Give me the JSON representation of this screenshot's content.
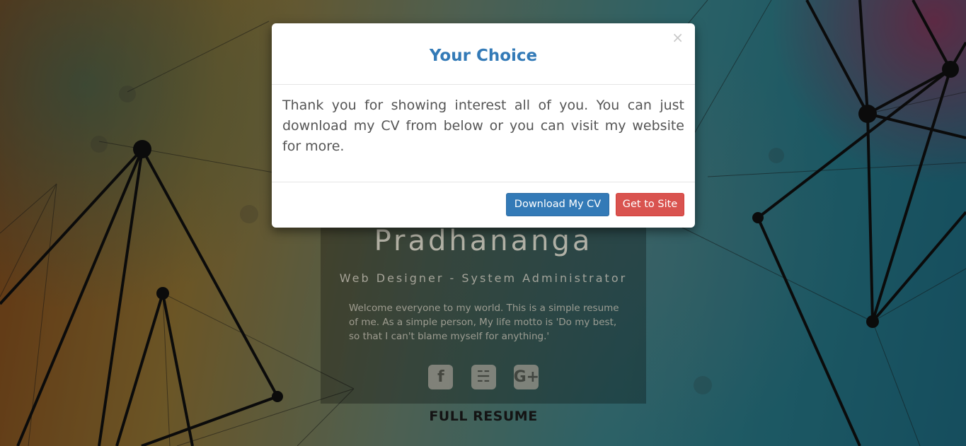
{
  "background": {
    "name_text": "Pradhananga",
    "role_text": "Web Designer - System Administrator",
    "intro_text": "Welcome everyone to my world. This is a simple resume of me. As a simple person, My life motto is 'Do my best, so that I can't blame myself for anything.'",
    "social": [
      {
        "icon": "facebook-icon",
        "glyph": "f"
      },
      {
        "icon": "twitter-icon",
        "glyph": "☵"
      },
      {
        "icon": "google-plus-icon",
        "glyph": "G+"
      }
    ],
    "full_resume_label": "FULL RESUME"
  },
  "modal": {
    "title": "Your Choice",
    "close_glyph": "×",
    "body_text": "Thank you for showing interest all of you. You can just download my CV from below or you can visit my website for more.",
    "primary_button": "Download My CV",
    "secondary_button": "Get to Site"
  },
  "colors": {
    "primary": "#337ab7",
    "danger": "#d9534f",
    "title": "#337ab7"
  }
}
